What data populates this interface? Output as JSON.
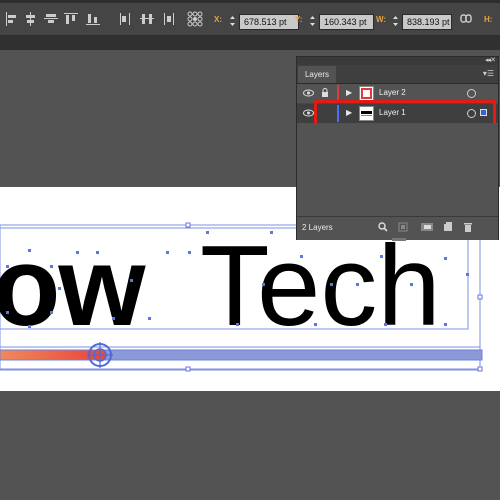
{
  "toolbar": {
    "x": {
      "label": "X:",
      "value": "678.513 pt"
    },
    "y": {
      "label": "Y:",
      "value": "160.343 pt"
    },
    "w": {
      "label": "W:",
      "value": "838.193 pt"
    }
  },
  "canvas": {
    "text": "owTech",
    "text_weight_part": "ow",
    "text_regular_part": "Tech"
  },
  "layers_panel": {
    "tab_label": "Layers",
    "menu_icon": "panel-menu-icon",
    "layers": [
      {
        "name": "Layer 2",
        "color": "#e0393e",
        "visible": true,
        "locked": true,
        "thumbnail": "red-box"
      },
      {
        "name": "Layer 1",
        "color": "#4a6ef5",
        "visible": true,
        "locked": false,
        "selected": true,
        "thumbnail": "black-text"
      }
    ],
    "footer_count": "2 Layers",
    "highlight_color": "#e41b14"
  }
}
